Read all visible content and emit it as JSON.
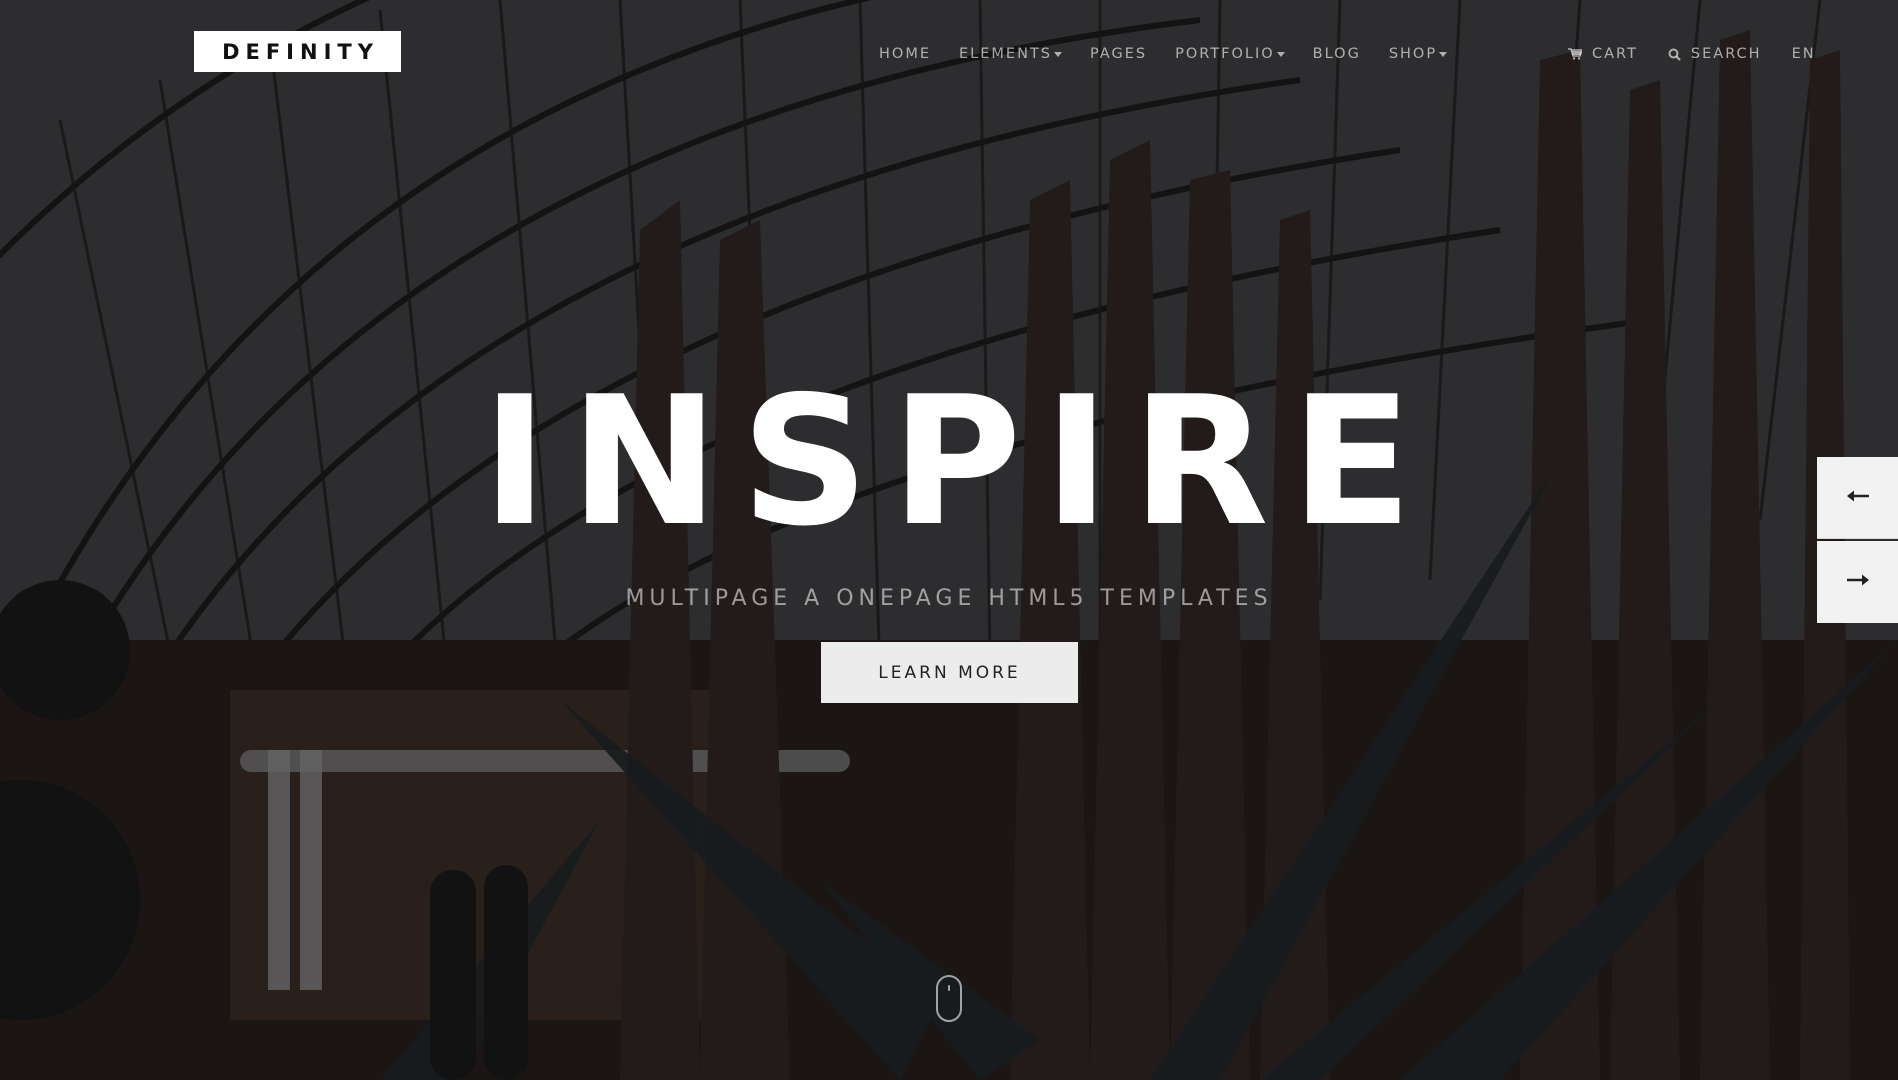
{
  "brand": {
    "logo_text": "DEFINITY"
  },
  "nav": {
    "items": [
      {
        "label": "HOME",
        "dropdown": false
      },
      {
        "label": "ELEMENTS",
        "dropdown": true
      },
      {
        "label": "PAGES",
        "dropdown": false
      },
      {
        "label": "PORTFOLIO",
        "dropdown": true
      },
      {
        "label": "BLOG",
        "dropdown": false
      },
      {
        "label": "SHOP",
        "dropdown": true
      }
    ],
    "cart_label": "CART",
    "cart_icon": "cart-icon",
    "search_label": "SEARCH",
    "search_icon": "search-icon",
    "language": "EN"
  },
  "hero": {
    "title": "INSPIRE",
    "subtitle": "MULTIPAGE A ONEPAGE HTML5 TEMPLATES",
    "cta_label": "LEARN MORE"
  },
  "slider": {
    "prev_icon": "arrow-left-icon",
    "next_icon": "arrow-right-icon"
  },
  "scroll_indicator": {
    "icon": "mouse-scroll-icon"
  },
  "colors": {
    "nav_text": "#9e9e9e",
    "hero_text": "#ffffff",
    "cta_bg": "#ececec",
    "arrow_bg": "#f2f2f2"
  }
}
